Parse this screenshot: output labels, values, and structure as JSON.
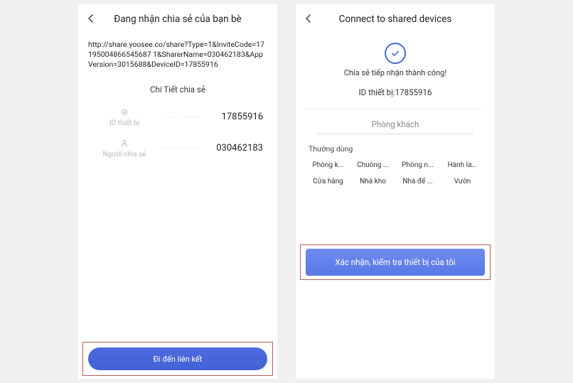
{
  "left": {
    "title": "Đang nhận chia sẻ của bạn bè",
    "url": "http://share.yoosee.co/share?Type=1&InviteCode=17195004866545687 1&SharerName=030462183&AppVersion=3015688&DeviceID=17855916",
    "details_title": "Chi Tiết chia sẻ",
    "device_label": "ID thiết bị",
    "device_value": "17855916",
    "sharer_label": "Người chia sẻ",
    "sharer_value": "030462183",
    "button": "Đi đến liên kết"
  },
  "right": {
    "title": "Connect to shared devices",
    "success": "Chia sẻ tiếp nhận thành công!",
    "device_id": "ID thiết bị:17855916",
    "room_placeholder": "Phòng khách",
    "common_label": "Thường dùng",
    "tags": [
      "Phòng k...",
      "Chuông ...",
      "Phòng n...",
      "Hành la...",
      "Cửa hàng",
      "Nhà kho",
      "Nhà để ...",
      "Vườn"
    ],
    "confirm": "Xác nhận, kiểm tra thiết bị của tôi"
  }
}
